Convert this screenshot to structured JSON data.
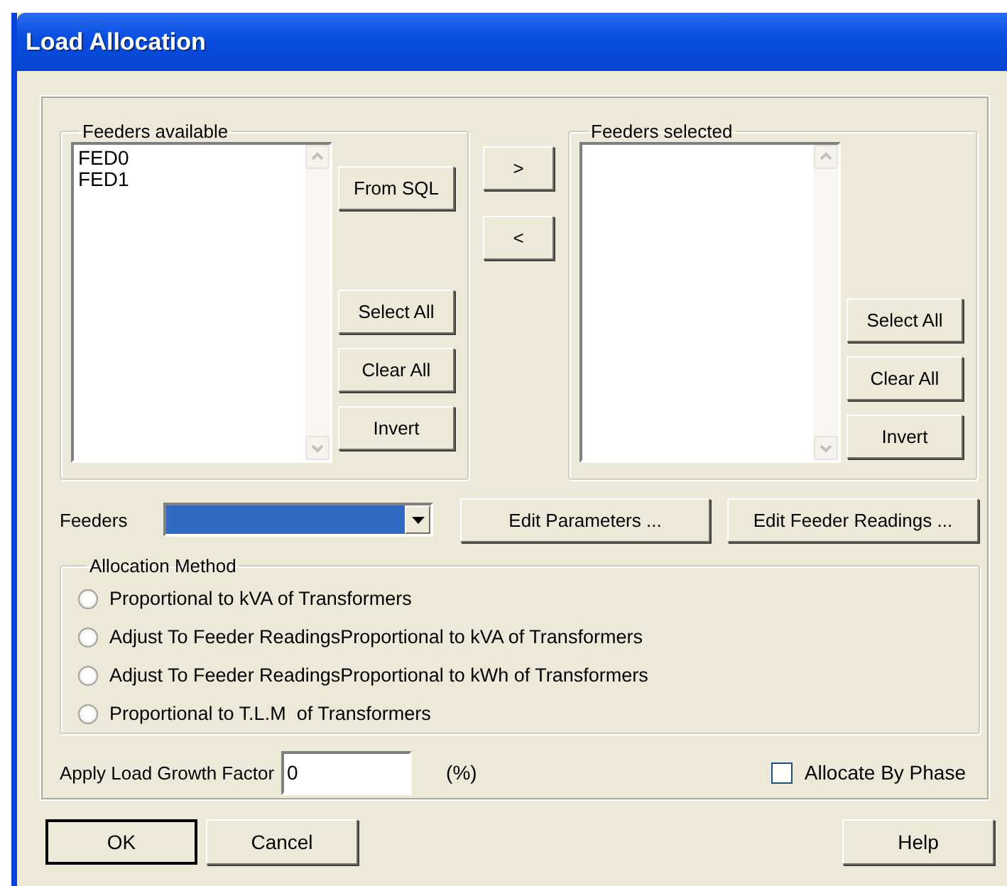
{
  "window": {
    "title": "Load Allocation"
  },
  "available": {
    "title": "Feeders available",
    "items": [
      "FED0",
      "FED1"
    ],
    "buttons": [
      "From SQL",
      "Select All",
      "Clear All",
      "Invert"
    ]
  },
  "move_buttons": [
    ">",
    "<"
  ],
  "selected": {
    "title": "Feeders selected",
    "buttons": [
      "Select All",
      "Clear All",
      "Invert"
    ]
  },
  "feeders": {
    "label": "Feeders",
    "highlighted": true
  },
  "edit_buttons": [
    "Edit Parameters ...",
    "Edit Feeder Readings ..."
  ],
  "allocation_method": {
    "title": "Allocation Method",
    "options": [
      {
        "label": "Proportional to kVA of Transformers",
        "selected": false
      },
      {
        "label": "Adjust To Feeder ReadingsProportional to kVA of Transformers",
        "selected": false
      },
      {
        "label": "Adjust To Feeder ReadingsProportional to kWh of Transformers",
        "selected": false
      },
      {
        "label": "Proportional to T.L.M  of Transformers",
        "selected": false
      }
    ]
  },
  "growth": {
    "label": "Apply Load Growth Factor",
    "value": "0",
    "unit": "(%)"
  },
  "allocate_by_phase": {
    "label": "Allocate By Phase",
    "checked": false
  },
  "buttons": [
    {
      "label": "OK",
      "default": true
    },
    {
      "label": "Cancel",
      "default": false
    },
    {
      "label": "Help",
      "default": false
    }
  ]
}
